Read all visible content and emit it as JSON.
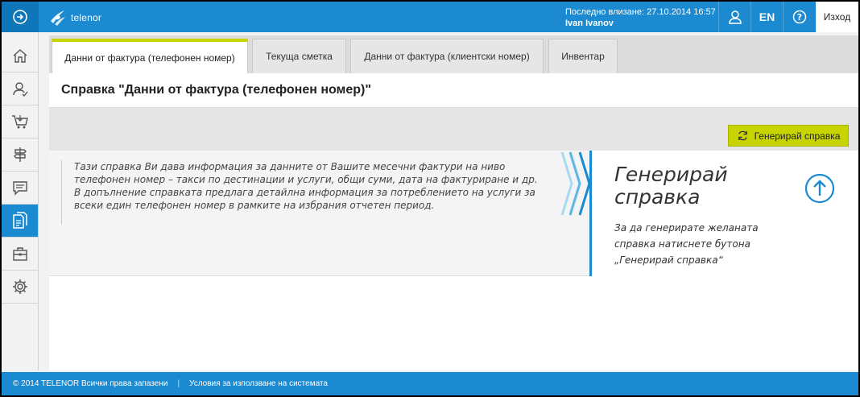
{
  "header": {
    "logo_text": "telenor",
    "last_login_label": "Последно влизане: 27.10.2014 16:57",
    "user_name": "Ivan Ivanov",
    "lang": "EN",
    "logout": "Изход",
    "icons": [
      "menu-toggle-icon",
      "user-icon",
      "help-icon"
    ]
  },
  "sidebar": {
    "items": [
      {
        "icon": "home-icon"
      },
      {
        "icon": "person-icon"
      },
      {
        "icon": "cart-icon"
      },
      {
        "icon": "signpost-icon"
      },
      {
        "icon": "chat-icon"
      },
      {
        "icon": "documents-icon",
        "active": true
      },
      {
        "icon": "briefcase-icon"
      },
      {
        "icon": "gear-icon"
      }
    ]
  },
  "tabs": [
    {
      "label": "Данни от фактура (телефонен номер)",
      "active": true
    },
    {
      "label": "Текуща сметка"
    },
    {
      "label": "Данни от фактура (клиентски номер)"
    },
    {
      "label": "Инвентар"
    }
  ],
  "page_title": "Справка \"Данни от фактура (телефонен номер)\"",
  "generate_button": "Генерирай справка",
  "description": "Тази справка Ви дава информация за данните от Вашите месечни фактури на ниво телефонен номер – такси по дестинации и услуги, общи суми, дата на фактуриране и др. В допълнение справката предлага детайлна информация за потреблението на услуги за всеки един телефонен номер в рамките на избрания отчетен период.",
  "hint": {
    "title_line1": "Генерирай",
    "title_line2": "справка",
    "text": "За да генерирате желаната справка натиснете бутона „Генерирай справка“"
  },
  "footer": {
    "copyright": "© 2014 TELENOR Всички права запазени",
    "terms": "Условия за използване на системата"
  },
  "colors": {
    "brand_blue": "#1b8ad0",
    "accent_green": "#c8d400"
  }
}
